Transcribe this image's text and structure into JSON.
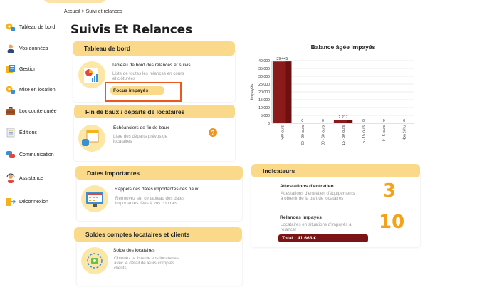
{
  "breadcrumb": {
    "home": "Accueil",
    "separator": ">",
    "current": "Suivi et relances"
  },
  "page_title": "Suivis Et Relances",
  "sidebar": {
    "items": [
      {
        "label": "Tableau de bord",
        "icon": "dashboard-icon"
      },
      {
        "label": "Vos données",
        "icon": "user-icon"
      },
      {
        "label": "Gestion",
        "icon": "management-icon"
      },
      {
        "label": "Mise en location",
        "icon": "rental-listing-icon"
      },
      {
        "label": "Loc courte durée",
        "icon": "suitcase-icon"
      },
      {
        "label": "Éditions",
        "icon": "document-icon"
      },
      {
        "label": "Communication",
        "icon": "chat-icon"
      },
      {
        "label": "Assistance",
        "icon": "assistance-icon"
      },
      {
        "label": "Déconnexion",
        "icon": "logout-icon"
      }
    ]
  },
  "sections": {
    "dashboard": {
      "heading": "Tableau de bord",
      "title": "Tableau de bord des relances et suivis",
      "desc1": "Liste de toutes les relances en cours",
      "desc2": "et clôturées",
      "button": "Focus impayés"
    },
    "leases": {
      "heading": "Fin de baux / départs de locataires",
      "title": "Echéanciers de fin de baux",
      "desc1": "Liste des départs prévus de",
      "desc2": "locataires",
      "help": "?"
    },
    "dates": {
      "heading": "Dates importantes",
      "title": "Rappels des dates importantes des baux",
      "desc1": "Retrouvez sur ce tableau des dates",
      "desc2": "importantes liées à vos contrats"
    },
    "balances": {
      "heading": "Soldes comptes locataires et clients",
      "title": "Solde des locataires",
      "desc1": "Obtenez la liste de vos locataires",
      "desc2": "avec le détail de leurs comptes",
      "desc3": "clients"
    }
  },
  "chart_data": {
    "type": "bar",
    "title": "Balance âgée impayés",
    "ylabel": "Impayés",
    "xlabel": "",
    "categories": [
      ">90 jours",
      "60 - 90 jours",
      "30 - 60 jours",
      "15 - 30 jours",
      "5 - 15 jours",
      "0 - 5 jours",
      "Non échu"
    ],
    "values": [
      39445,
      0,
      0,
      2217,
      0,
      0,
      0
    ],
    "value_labels": [
      "39 445",
      "0",
      "0",
      "2 217",
      "0",
      "0",
      "0"
    ],
    "yticks": [
      0,
      5000,
      10000,
      15000,
      20000,
      25000,
      30000,
      35000,
      40000
    ],
    "ytick_labels": [
      "0",
      "5 000",
      "10 000",
      "15 000",
      "20 000",
      "25 000",
      "30 000",
      "35 000",
      "40 000"
    ],
    "ylim": [
      0,
      40000
    ],
    "grid": true,
    "bar_color": "#8b1a1a"
  },
  "indicators": {
    "heading": "Indicateurs",
    "items": [
      {
        "title": "Attestations d'entretien",
        "desc1": "Attestations d'entretien d'équipements",
        "desc2": "à obtenir de la part de locataires",
        "value": "3"
      },
      {
        "title": "Relances impayés",
        "desc1": "Locataires en situations d'impayés à",
        "desc2": "relancer",
        "value": "10",
        "total": "Total : 41 663 €"
      }
    ]
  },
  "colors": {
    "accent": "#fbd98b",
    "highlight": "#e8581f",
    "number": "#f5a21b",
    "bar": "#8b1a1a"
  }
}
